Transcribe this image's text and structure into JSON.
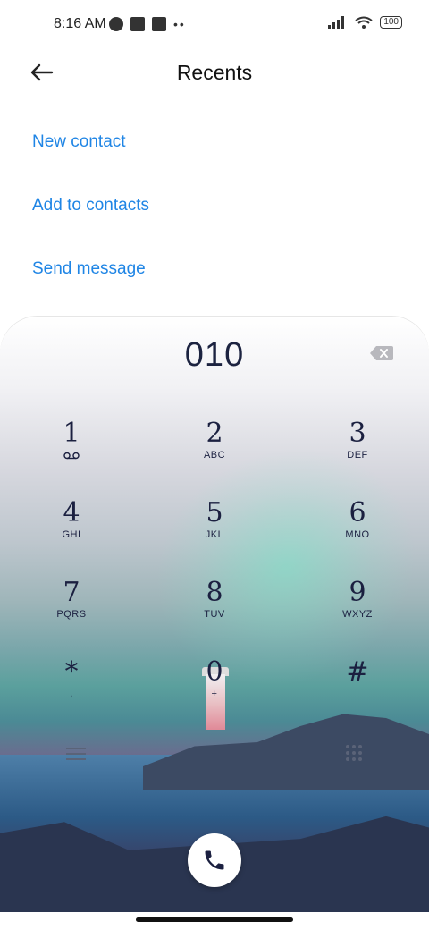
{
  "status_bar": {
    "time": "8:16 AM",
    "battery": "100"
  },
  "header": {
    "title": "Recents"
  },
  "actions": [
    {
      "label": "New contact"
    },
    {
      "label": "Add to contacts"
    },
    {
      "label": "Send message"
    }
  ],
  "dialer": {
    "number": "010",
    "keys": [
      {
        "digit": "1",
        "letters": ""
      },
      {
        "digit": "2",
        "letters": "ABC"
      },
      {
        "digit": "3",
        "letters": "DEF"
      },
      {
        "digit": "4",
        "letters": "GHI"
      },
      {
        "digit": "5",
        "letters": "JKL"
      },
      {
        "digit": "6",
        "letters": "MNO"
      },
      {
        "digit": "7",
        "letters": "PQRS"
      },
      {
        "digit": "8",
        "letters": "TUV"
      },
      {
        "digit": "9",
        "letters": "WXYZ"
      },
      {
        "digit": "*",
        "letters": ","
      },
      {
        "digit": "0",
        "letters": "+"
      },
      {
        "digit": "#",
        "letters": ""
      }
    ]
  },
  "icons": {
    "back": "arrow-left-icon",
    "backspace": "backspace-icon",
    "voicemail": "voicemail-icon",
    "menu": "menu-icon",
    "keypad": "keypad-icon",
    "call": "phone-icon"
  },
  "colors": {
    "accent": "#1f85e5",
    "digits": "#1b2040"
  }
}
